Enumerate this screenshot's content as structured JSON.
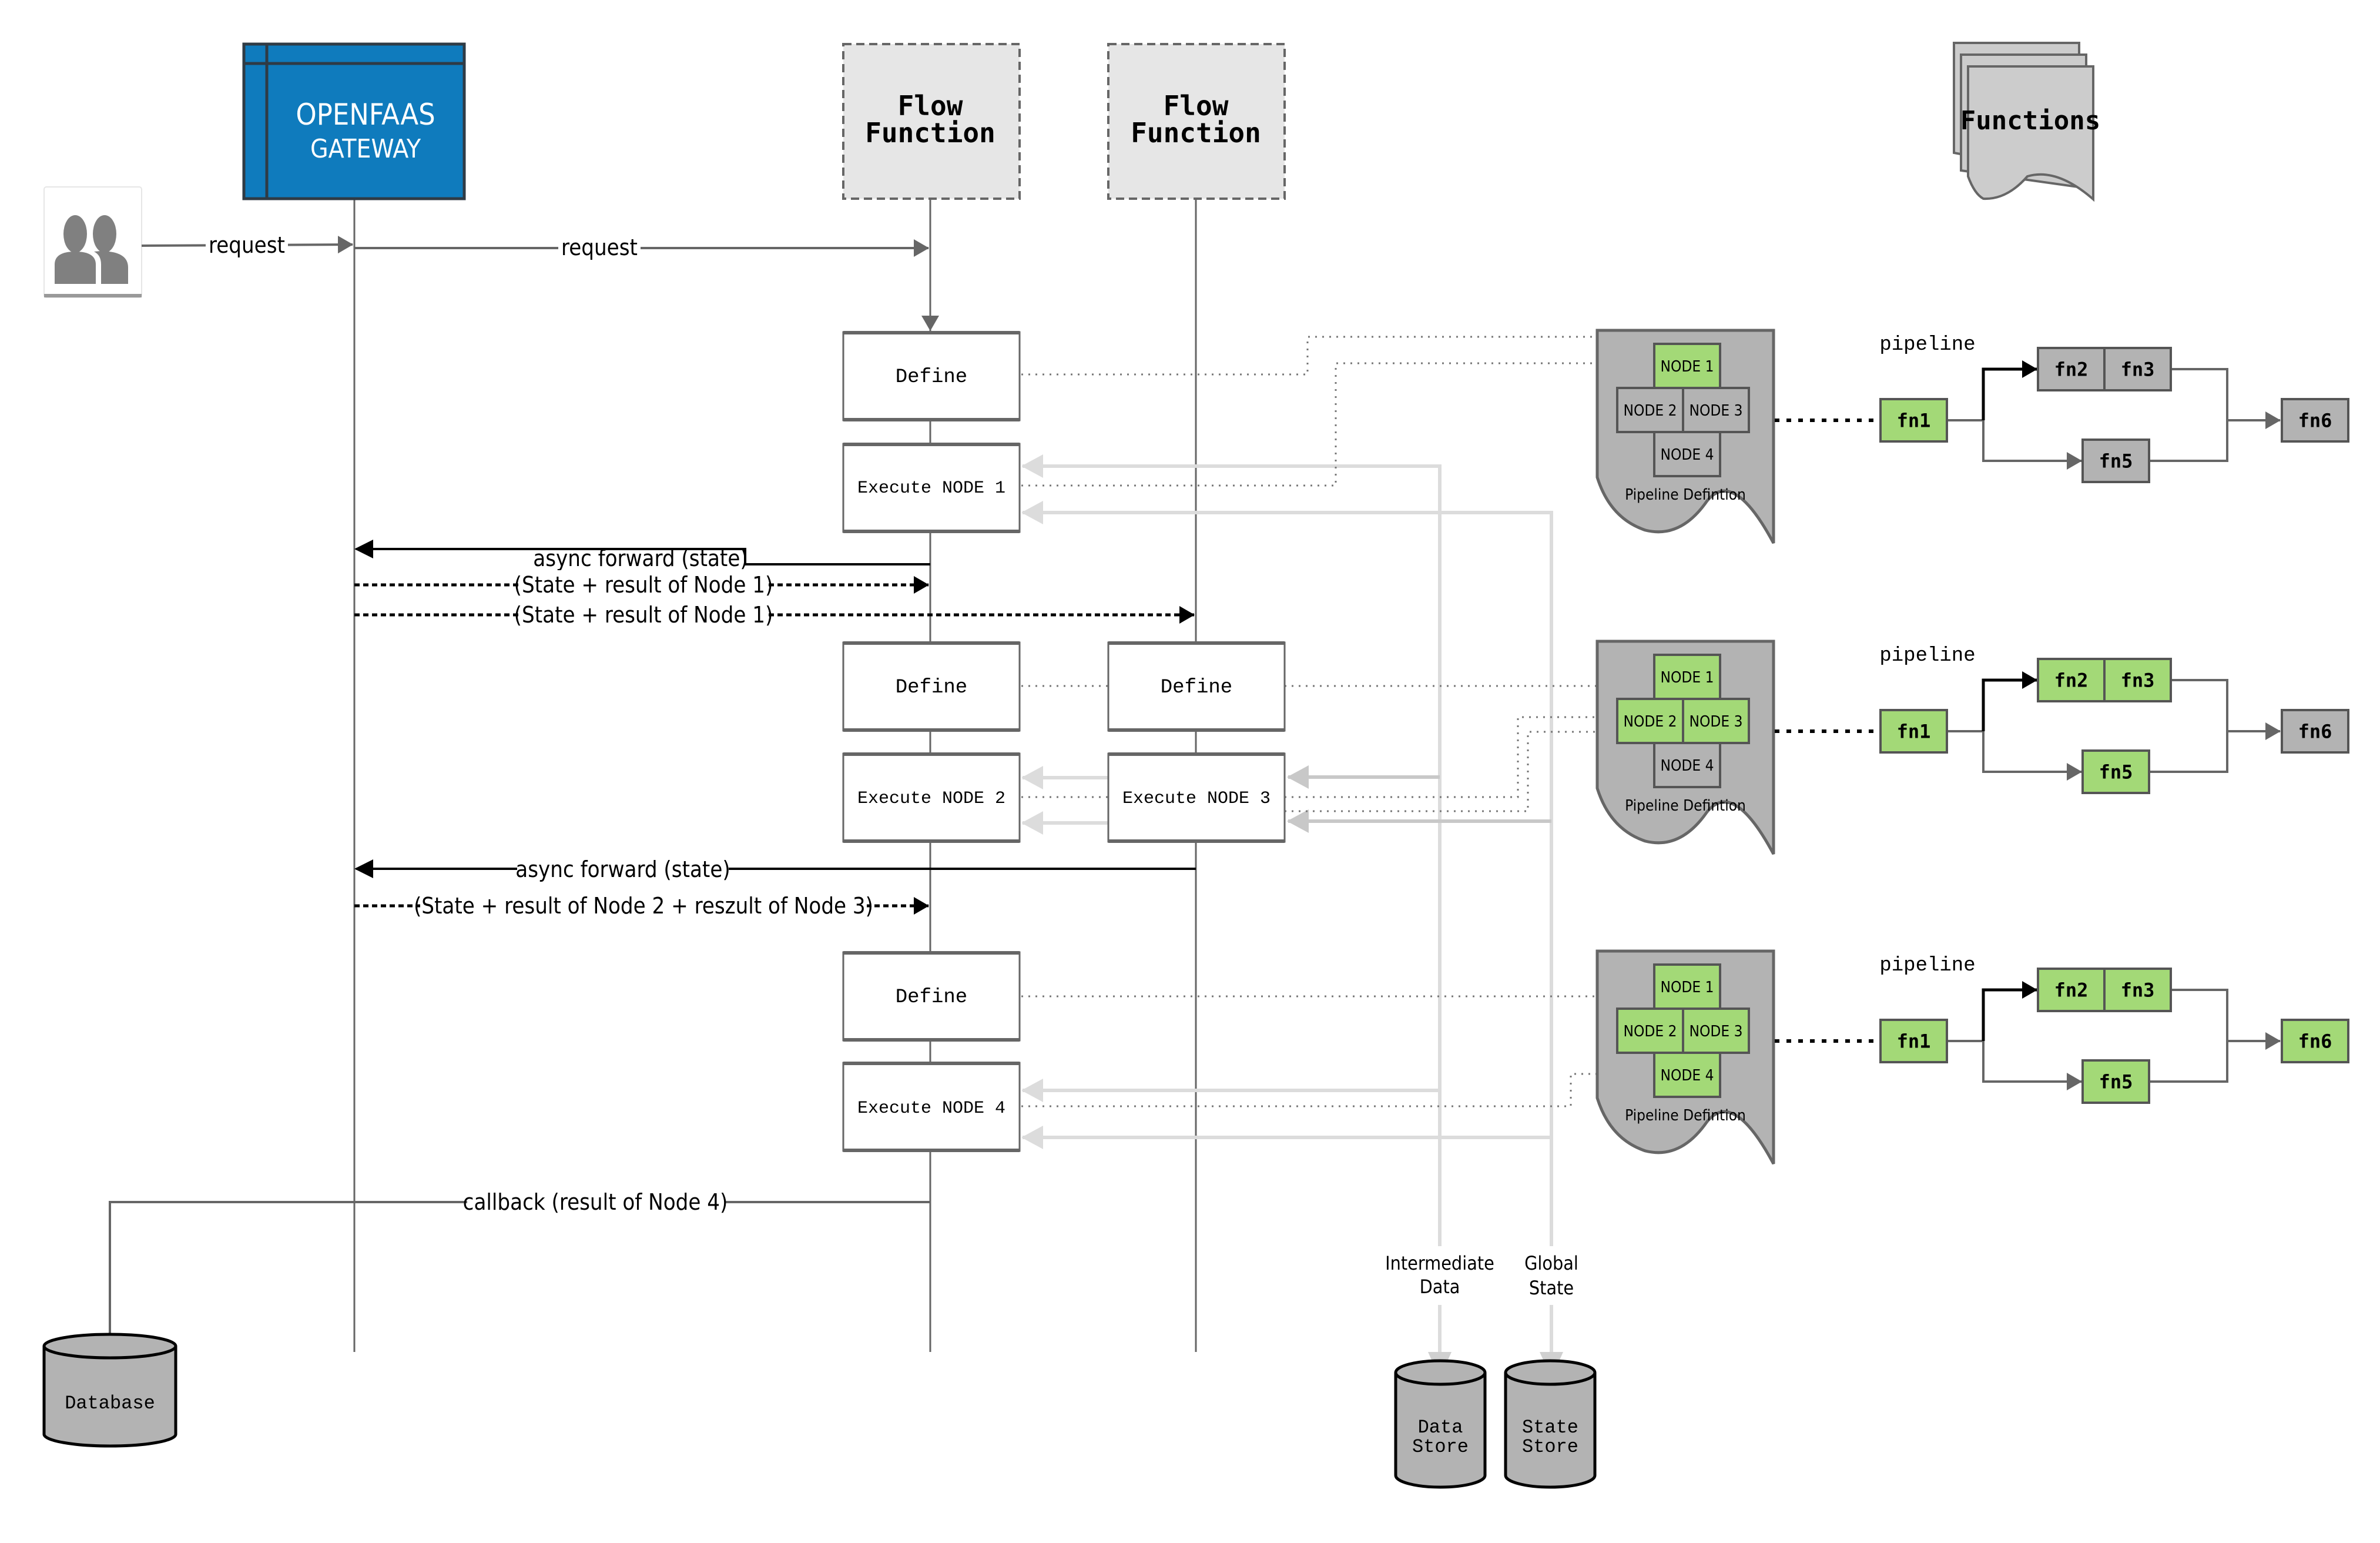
{
  "actors": {
    "user_icon": "users-icon",
    "gateway": {
      "line1": "OPENFAAS",
      "line2": "GATEWAY",
      "fill": "#0f7bbd"
    },
    "flow_function_1": {
      "line1": "Flow",
      "line2": "Function"
    },
    "flow_function_2": {
      "line1": "Flow",
      "line2": "Function"
    },
    "functions_stack": {
      "label": "Functions"
    }
  },
  "messages": {
    "request_user_gateway": "request",
    "request_gateway_flow": "request",
    "async_forward_1": "async forward (state)",
    "state_node1_to_ff1": "(State + result of Node 1)",
    "state_node1_to_ff2": "(State + result of Node 1)",
    "async_forward_2": "async forward (state)",
    "state_node23_to_ff1": "(State + result of Node 2 + reszult of Node 3)",
    "callback": "callback (result of Node 4)"
  },
  "activations": {
    "ff1_define_1": "Define",
    "ff1_execute_1": "Execute NODE 1",
    "ff1_define_2": "Define",
    "ff1_execute_2": "Execute NODE 2",
    "ff2_define": "Define",
    "ff2_execute_3": "Execute NODE 3",
    "ff1_define_3": "Define",
    "ff1_execute_4": "Execute NODE 4"
  },
  "stores": {
    "database": "Database",
    "data_store": {
      "line1": "Data",
      "line2": "Store"
    },
    "state_store": {
      "line1": "State",
      "line2": "Store"
    },
    "intermediate_label": {
      "line1": "Intermediate",
      "line2": "Data"
    },
    "global_label": {
      "line1": "Global",
      "line2": "State"
    }
  },
  "colors": {
    "done_green": "#a3d977",
    "pending_gray": "#b3b3b3",
    "line_gray": "#666666",
    "store_arrow": "#d9d9d9"
  },
  "stages": [
    {
      "pipeline_definition_label": "Pipeline Defintion",
      "pipeline_label": "pipeline",
      "nodes": [
        {
          "label": "NODE 1",
          "done": true
        },
        {
          "label": "NODE 2",
          "done": false
        },
        {
          "label": "NODE 3",
          "done": false
        },
        {
          "label": "NODE 4",
          "done": false
        }
      ],
      "fns": [
        {
          "label": "fn1",
          "done": true
        },
        {
          "label": "fn2",
          "done": false
        },
        {
          "label": "fn3",
          "done": false
        },
        {
          "label": "fn5",
          "done": false
        },
        {
          "label": "fn6",
          "done": false
        }
      ]
    },
    {
      "pipeline_definition_label": "Pipeline Defintion",
      "pipeline_label": "pipeline",
      "nodes": [
        {
          "label": "NODE 1",
          "done": true
        },
        {
          "label": "NODE 2",
          "done": true
        },
        {
          "label": "NODE 3",
          "done": true
        },
        {
          "label": "NODE 4",
          "done": false
        }
      ],
      "fns": [
        {
          "label": "fn1",
          "done": true
        },
        {
          "label": "fn2",
          "done": true
        },
        {
          "label": "fn3",
          "done": true
        },
        {
          "label": "fn5",
          "done": true
        },
        {
          "label": "fn6",
          "done": false
        }
      ]
    },
    {
      "pipeline_definition_label": "Pipeline Defintion",
      "pipeline_label": "pipeline",
      "nodes": [
        {
          "label": "NODE 1",
          "done": true
        },
        {
          "label": "NODE 2",
          "done": true
        },
        {
          "label": "NODE 3",
          "done": true
        },
        {
          "label": "NODE 4",
          "done": true
        }
      ],
      "fns": [
        {
          "label": "fn1",
          "done": true
        },
        {
          "label": "fn2",
          "done": true
        },
        {
          "label": "fn3",
          "done": true
        },
        {
          "label": "fn5",
          "done": true
        },
        {
          "label": "fn6",
          "done": true
        }
      ]
    }
  ]
}
